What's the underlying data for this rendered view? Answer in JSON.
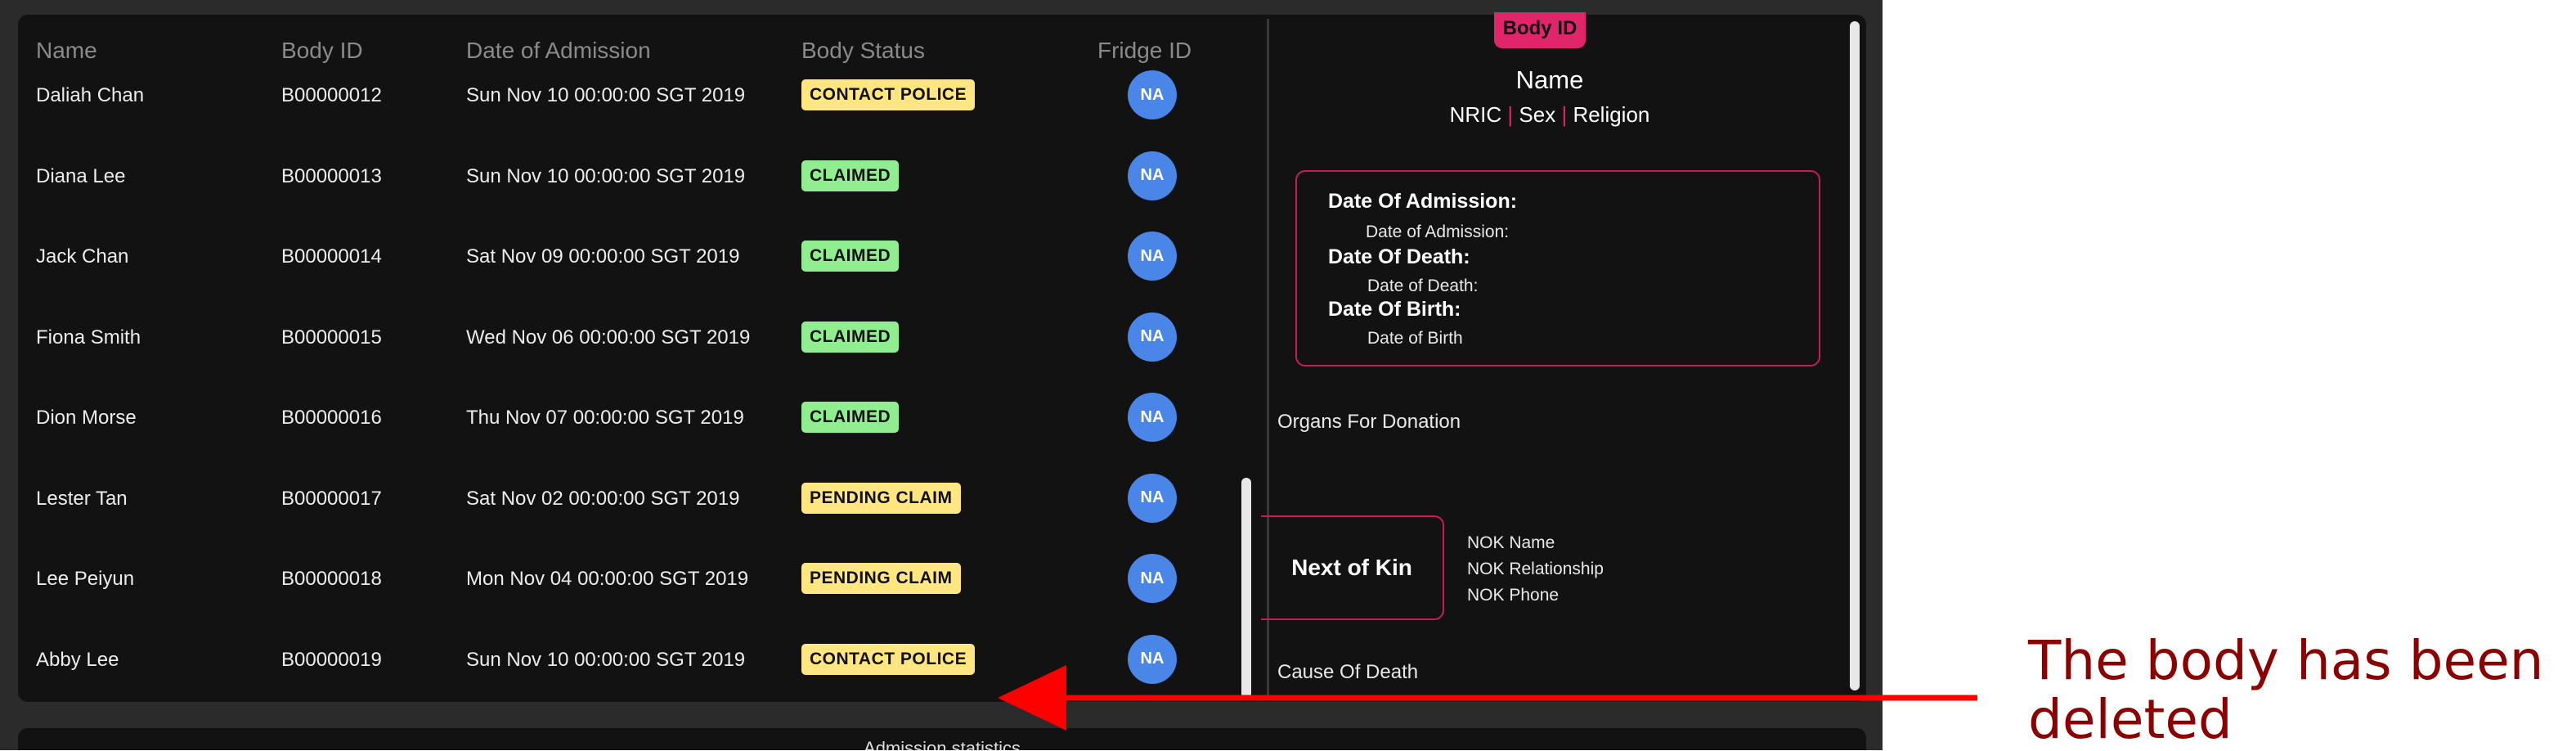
{
  "columns": {
    "name": "Name",
    "body_id": "Body ID",
    "admission": "Date of Admission",
    "status": "Body Status",
    "fridge": "Fridge ID"
  },
  "rows": [
    {
      "name": "Daliah Chan",
      "body_id": "B00000012",
      "admission": "Sun Nov 10 00:00:00 SGT 2019",
      "status": "CONTACT POLICE",
      "fridge": "NA"
    },
    {
      "name": "Diana Lee",
      "body_id": "B00000013",
      "admission": "Sun Nov 10 00:00:00 SGT 2019",
      "status": "CLAIMED",
      "fridge": "NA"
    },
    {
      "name": "Jack Chan",
      "body_id": "B00000014",
      "admission": "Sat Nov 09 00:00:00 SGT 2019",
      "status": "CLAIMED",
      "fridge": "NA"
    },
    {
      "name": "Fiona Smith",
      "body_id": "B00000015",
      "admission": "Wed Nov 06 00:00:00 SGT 2019",
      "status": "CLAIMED",
      "fridge": "NA"
    },
    {
      "name": "Dion Morse",
      "body_id": "B00000016",
      "admission": "Thu Nov 07 00:00:00 SGT 2019",
      "status": "CLAIMED",
      "fridge": "NA"
    },
    {
      "name": "Lester Tan",
      "body_id": "B00000017",
      "admission": "Sat Nov 02 00:00:00 SGT 2019",
      "status": "PENDING CLAIM",
      "fridge": "NA"
    },
    {
      "name": "Lee Peiyun",
      "body_id": "B00000018",
      "admission": "Mon Nov 04 00:00:00 SGT 2019",
      "status": "PENDING CLAIM",
      "fridge": "NA"
    },
    {
      "name": "Abby Lee",
      "body_id": "B00000019",
      "admission": "Sun Nov 10 00:00:00 SGT 2019",
      "status": "CONTACT POLICE",
      "fridge": "NA"
    }
  ],
  "status_colors": {
    "CONTACT POLICE": "#ffe680",
    "CLAIMED": "#90ee90",
    "PENDING CLAIM": "#ffe680"
  },
  "detail": {
    "badge": "Body ID",
    "name": "Name",
    "nric": "NRIC",
    "sex": "Sex",
    "religion": "Religion",
    "separator": "|",
    "admission_label": "Date Of Admission:",
    "admission_value": "Date of Admission:",
    "death_label": "Date Of Death:",
    "death_value": "Date of Death:",
    "birth_label": "Date Of Birth:",
    "birth_value": "Date of Birth",
    "organs": "Organs For Donation",
    "nok_title": "Next of Kin",
    "nok_name": "NOK Name",
    "nok_relationship": "NOK Relationship",
    "nok_phone": "NOK Phone",
    "cause": "Cause Of Death"
  },
  "stats": {
    "title": "Admission statistics"
  },
  "annotation": {
    "line1": "The body has been",
    "line2": "deleted",
    "color": "#8b0000",
    "arrow_color": "#ff0000"
  }
}
